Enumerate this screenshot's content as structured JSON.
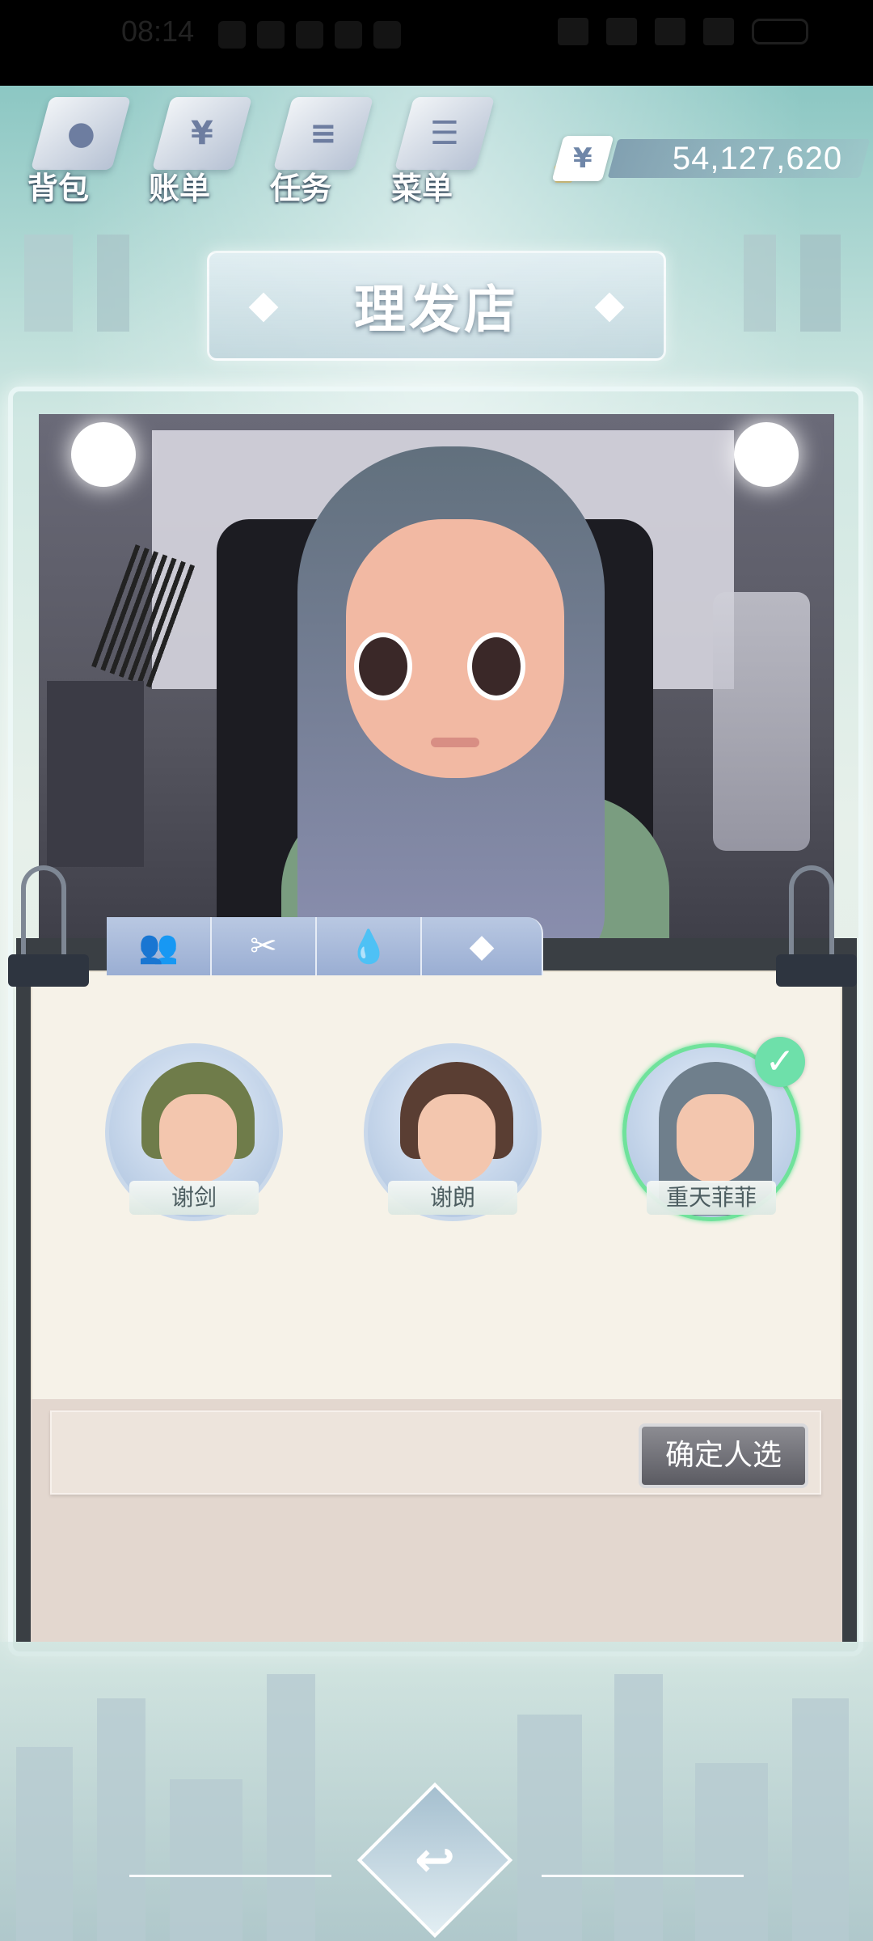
{
  "status_bar": {
    "time": "08:14"
  },
  "top_menu": {
    "items": [
      {
        "label": "背包",
        "icon": "backpack-icon"
      },
      {
        "label": "账单",
        "icon": "bill-icon",
        "glyph": "¥"
      },
      {
        "label": "任务",
        "icon": "task-list-icon"
      },
      {
        "label": "菜单",
        "icon": "menu-icon"
      }
    ]
  },
  "money": {
    "currency_symbol": "¥",
    "value": "54,127,620"
  },
  "title": "理发店",
  "tabs": [
    {
      "icon": "people-icon",
      "glyph": "👥"
    },
    {
      "icon": "scissors-icon",
      "glyph": "✂"
    },
    {
      "icon": "dye-icon",
      "glyph": "💧"
    },
    {
      "icon": "makeup-icon",
      "glyph": "◆"
    }
  ],
  "characters": [
    {
      "name": "谢剑",
      "selected": false,
      "hair_color": "#6f7c4a"
    },
    {
      "name": "谢朗",
      "selected": false,
      "hair_color": "#5a3e33"
    },
    {
      "name": "重天菲菲",
      "selected": true,
      "hair_color": "#6f7f8c",
      "check": "✓"
    }
  ],
  "confirm_button": "确定人选",
  "back_button": "back-icon",
  "back_glyph": "↩"
}
